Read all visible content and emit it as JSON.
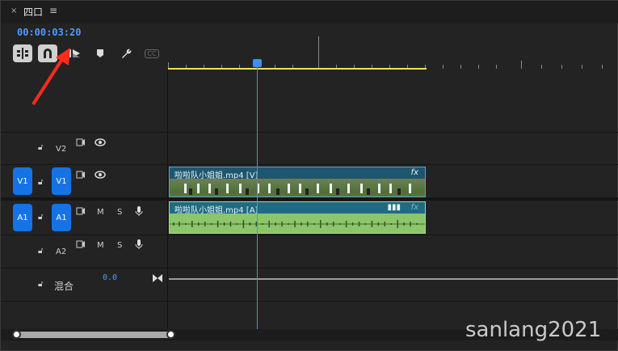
{
  "tab": {
    "close": "×",
    "title": "四口",
    "menu": "≡"
  },
  "timecode": "00:00:03:20",
  "tools": [
    {
      "name": "snap",
      "icon": "snap-icon"
    },
    {
      "name": "linked",
      "icon": "magnet-icon"
    },
    {
      "name": "markers",
      "icon": "marker-play-icon"
    },
    {
      "name": "add-marker",
      "icon": "marker-icon"
    },
    {
      "name": "settings",
      "icon": "wrench-icon"
    },
    {
      "name": "captions",
      "icon": "cc-icon",
      "label": "CC"
    }
  ],
  "tracks": {
    "v2": {
      "name": "V2"
    },
    "v1": {
      "name": "V1",
      "source": "V1",
      "target": "V1"
    },
    "a1": {
      "name": "A1",
      "source": "A1",
      "target": "A1",
      "m": "M",
      "s": "S"
    },
    "a2": {
      "name": "A2",
      "m": "M",
      "s": "S"
    },
    "mix": {
      "name": "混合",
      "value": "0.0"
    }
  },
  "clips": {
    "video": {
      "label": "啦啦队小姐姐.mp4 [V]",
      "fx": "fx"
    },
    "audio": {
      "label": "啦啦队小姐姐.mp4 [A]",
      "fx": "fx"
    }
  },
  "watermark": "sanlang2021",
  "colors": {
    "accent": "#1473e6",
    "timecode": "#4d9bff",
    "work_area": "#f4e24a",
    "video_clip": "#2e6e8a",
    "audio_clip": "#8cc56b"
  }
}
